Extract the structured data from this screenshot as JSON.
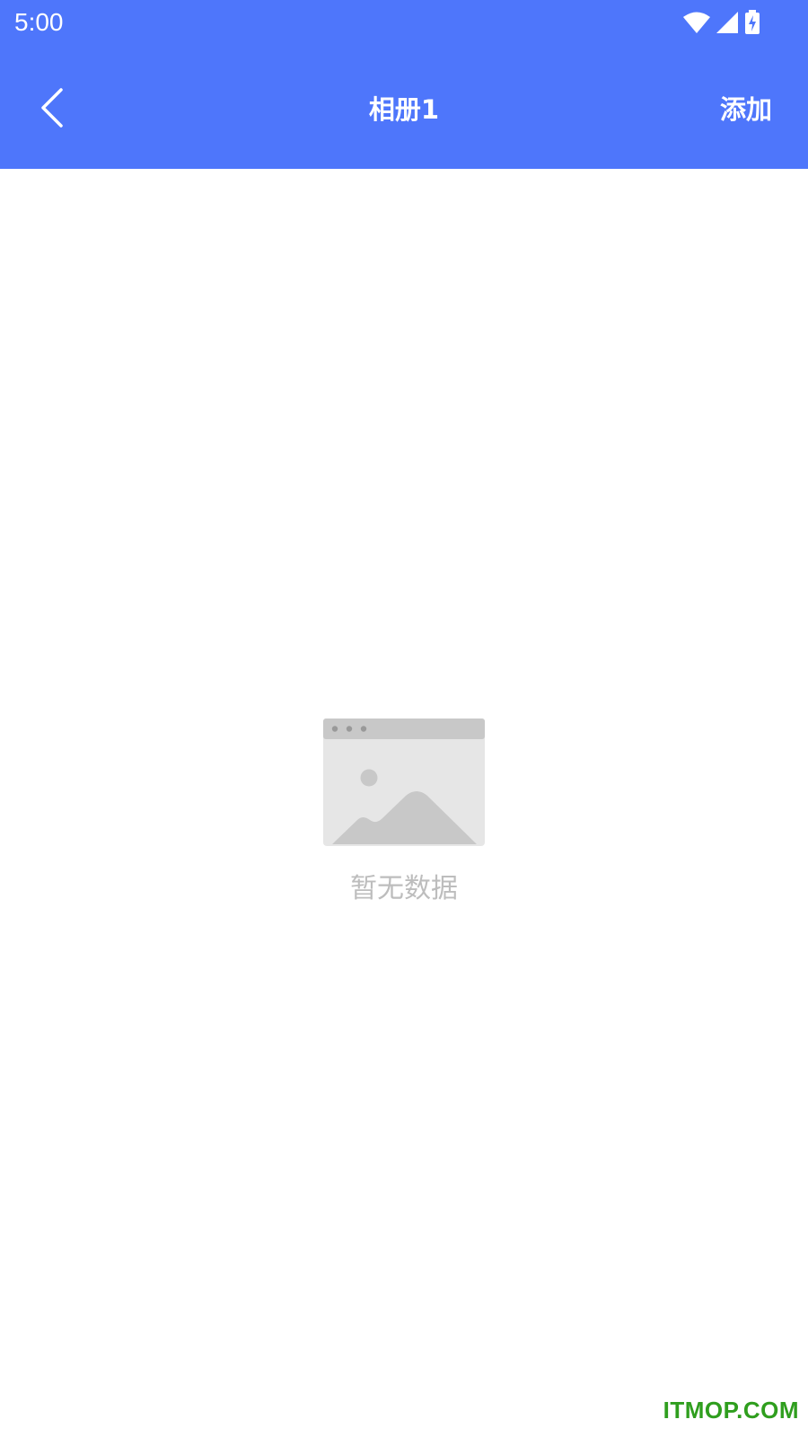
{
  "status_bar": {
    "time": "5:00",
    "icons": [
      "wifi-icon",
      "cellular-signal-icon",
      "battery-charging-icon"
    ]
  },
  "header": {
    "title": "相册1",
    "back_icon": "chevron-left-icon",
    "add_label": "添加",
    "background_color": "#4e76fb"
  },
  "empty_state": {
    "icon": "image-placeholder-icon",
    "message": "暂无数据"
  },
  "watermark": {
    "text": "ITMOP.COM",
    "color": "#2f9e1e"
  }
}
